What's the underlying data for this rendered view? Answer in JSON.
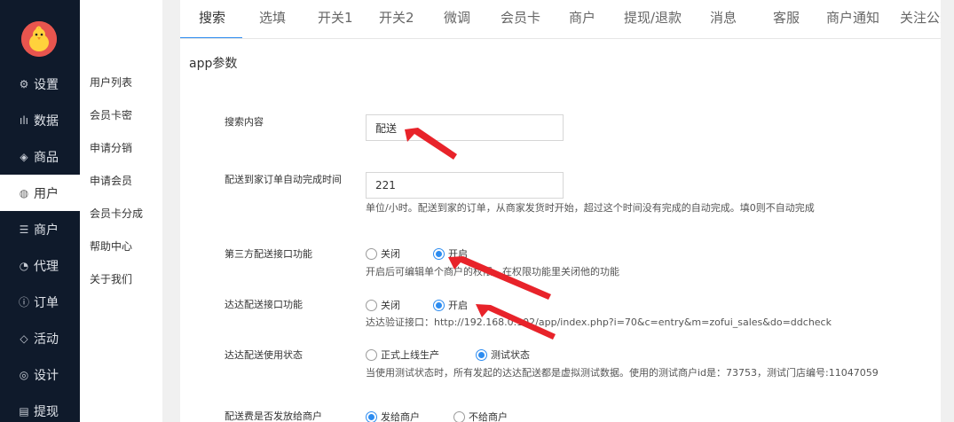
{
  "sidebar": {
    "items": [
      {
        "icon": "gear-icon",
        "glyph": "⚙",
        "label": "设置"
      },
      {
        "icon": "bar-chart-icon",
        "glyph": "ılı",
        "label": "数据"
      },
      {
        "icon": "cube-icon",
        "glyph": "◈",
        "label": "商品"
      },
      {
        "icon": "user-icon",
        "glyph": "◍",
        "label": "用户"
      },
      {
        "icon": "store-icon",
        "glyph": "☰",
        "label": "商户"
      },
      {
        "icon": "agent-icon",
        "glyph": "◔",
        "label": "代理"
      },
      {
        "icon": "order-icon",
        "glyph": "ⓘ",
        "label": "订单"
      },
      {
        "icon": "tag-icon",
        "glyph": "◇",
        "label": "活动"
      },
      {
        "icon": "design-icon",
        "glyph": "◎",
        "label": "设计"
      },
      {
        "icon": "withdraw-icon",
        "glyph": "▤",
        "label": "提现"
      }
    ],
    "active": "用户"
  },
  "subnav": {
    "items": [
      "用户列表",
      "会员卡密",
      "申请分销",
      "申请会员",
      "会员卡分成",
      "帮助中心",
      "关于我们"
    ]
  },
  "tabs": [
    "搜索",
    "选填",
    "开关1",
    "开关2",
    "微调",
    "会员卡",
    "商户",
    "提现/退款",
    "消息",
    "客服",
    "商户通知",
    "关注公众"
  ],
  "active_tab": "搜索",
  "section_title": "app参数",
  "form": {
    "search": {
      "label": "搜索内容",
      "value": "配送"
    },
    "auto_complete": {
      "label": "配送到家订单自动完成时间",
      "value": "221",
      "help": "单位/小时。配送到家的订单，从商家发货时开始，超过这个时间没有完成的自动完成。填0则不自动完成"
    },
    "third_party": {
      "label": "第三方配送接口功能",
      "options": [
        "关闭",
        "开启"
      ],
      "selected": "开启",
      "help": "开启后可编辑单个商户的权限，在权限功能里关闭他的功能"
    },
    "dada": {
      "label": "达达配送接口功能",
      "options": [
        "关闭",
        "开启"
      ],
      "selected": "开启",
      "help": "达达验证接口：http://192.168.0.102/app/index.php?i=70&c=entry&m=zofui_sales&do=ddcheck"
    },
    "dada_status": {
      "label": "达达配送使用状态",
      "options": [
        "正式上线生产",
        "测试状态"
      ],
      "selected": "测试状态",
      "help": "当使用测试状态时，所有发起的达达配送都是虚拟测试数据。使用的测试商户id是：73753，测试门店编号:11047059"
    },
    "fee_to_merchant": {
      "label": "配送费是否发放给商户",
      "options": [
        "发给商户",
        "不给商户"
      ],
      "selected": "发给商户"
    }
  },
  "colors": {
    "sidebar": "#0f1a2b",
    "accent": "#2d8cf0",
    "annotation": "#e8232a"
  }
}
